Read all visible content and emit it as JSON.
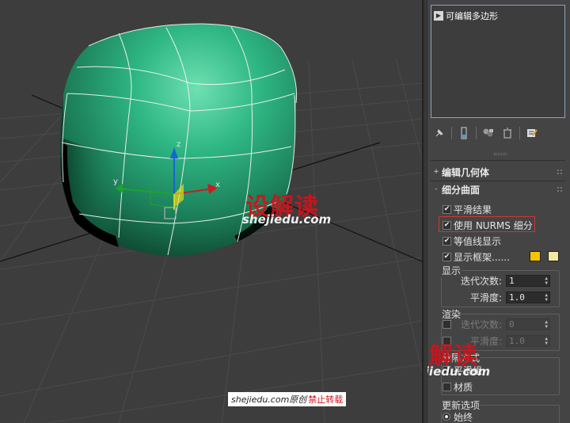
{
  "modifier_stack": {
    "items": [
      {
        "label": "可编辑多边形"
      }
    ]
  },
  "toolbar": {
    "icons": [
      "pin-stack-icon",
      "show-end-result-icon",
      "make-unique-icon",
      "remove-modifier-icon",
      "configure-modifier-sets-icon"
    ]
  },
  "rollouts": {
    "edit_geometry": {
      "sign": "+",
      "title": "编辑几何体"
    },
    "subdivision_surface": {
      "sign": "-",
      "title": "细分曲面"
    }
  },
  "options": {
    "smooth_result": {
      "label": "平滑结果",
      "checked": true
    },
    "use_nurms": {
      "label": "使用 NURMS 细分",
      "checked": true
    },
    "isoline_display": {
      "label": "等值线显示",
      "checked": true
    },
    "show_cage": {
      "label": "显示框架......",
      "checked": true
    }
  },
  "cage_colors": {
    "color1": "#f5c400",
    "color2": "#f1e7a0"
  },
  "display_group": {
    "title": "显示",
    "iterations": {
      "label": "迭代次数:",
      "value": "1"
    },
    "smoothness": {
      "label": "平滑度:",
      "value": "1.0"
    }
  },
  "render_group": {
    "title": "渲染",
    "iterations": {
      "label": "迭代次数:",
      "value": "0",
      "checked": false
    },
    "smoothness": {
      "label": "平滑度:",
      "value": "1.0",
      "checked": false
    }
  },
  "separate_by": {
    "title": "分隔方式",
    "smoothing_groups": {
      "label": "平滑组",
      "checked": false
    },
    "materials": {
      "label": "材质",
      "checked": false
    }
  },
  "update_options": {
    "title": "更新选项",
    "always": {
      "label": "始终",
      "selected": true
    }
  },
  "gizmo_axes": {
    "x": "x",
    "y": "y",
    "z": "z"
  },
  "watermarks": {
    "brand_cn": "设解读",
    "brand_en": "shejiedu.com",
    "credit_site": "shejiedu.com原创",
    "credit_notice": "禁止转载"
  },
  "colors": {
    "object": "#2db07f",
    "panel_bg": "#444444",
    "viewport_bg": "#3d3d3d",
    "highlight": "#d03535"
  }
}
